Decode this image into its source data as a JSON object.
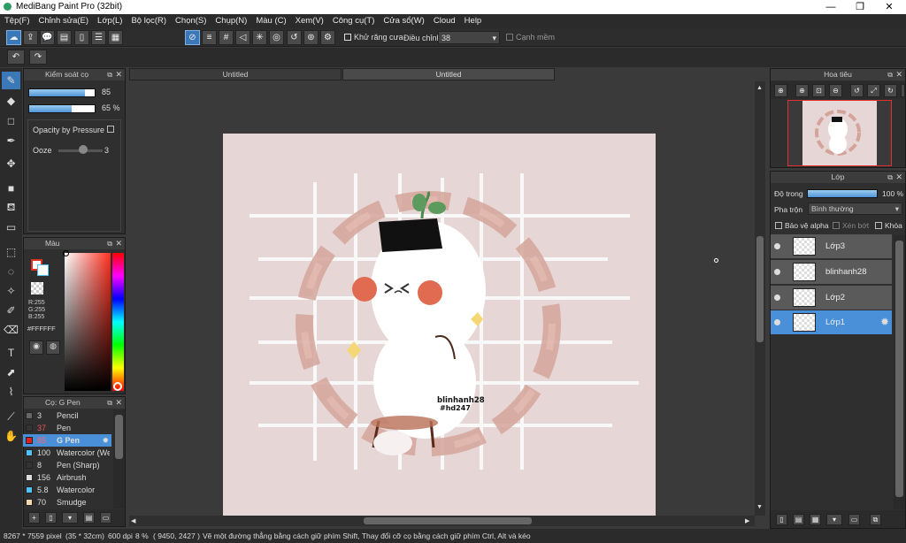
{
  "window": {
    "title": "MediBang Paint Pro (32bit)",
    "minimize": "—",
    "maximize": "❐",
    "close": "✕"
  },
  "menu": [
    "Tệp(F)",
    "Chỉnh sửa(E)",
    "Lớp(L)",
    "Bộ lọc(R)",
    "Chọn(S)",
    "Chụp(N)",
    "Màu (C)",
    "Xem(V)",
    "Công cụ(T)",
    "Cửa sổ(W)",
    "Cloud",
    "Help"
  ],
  "toolbar": {
    "antialias_label": "Khử răng cưa",
    "adjust_label": "Điều chỉnh",
    "adjust_value": "38",
    "edge_label": "Cạnh mềm"
  },
  "tabs": [
    "Untitled",
    "Untitled"
  ],
  "brush_control": {
    "title": "Kiểm soát cọ",
    "size_value": "85",
    "size_fraction": 0.85,
    "opacity_value": "65 %",
    "opacity_fraction": 0.65,
    "opacity_pressure_label": "Opacity by Pressure",
    "ooze_label": "Ooze",
    "ooze_value": "3"
  },
  "color_panel": {
    "title": "Màu",
    "r": "R:255",
    "g": "G:255",
    "b": "B:255",
    "hex": "#FFFFFF"
  },
  "brush_list": {
    "title": "Cọ: G Pen",
    "items": [
      {
        "size": "3",
        "name": "Pencil",
        "color": "#666666"
      },
      {
        "size": "37",
        "name": "Pen",
        "color": "#333333"
      },
      {
        "size": "85",
        "name": "G Pen",
        "color": "#e02020"
      },
      {
        "size": "100",
        "name": "Watercolor (We",
        "color": "#4fc3f7"
      },
      {
        "size": "8",
        "name": "Pen (Sharp)",
        "color": "#333333"
      },
      {
        "size": "156",
        "name": "Airbrush",
        "color": "#dddddd"
      },
      {
        "size": "5.8",
        "name": "Watercolor",
        "color": "#4fc3f7"
      },
      {
        "size": "70",
        "name": "Smudge",
        "color": "#f5d6b0"
      }
    ]
  },
  "navigator": {
    "title": "Hoa tiêu"
  },
  "layer_panel": {
    "title": "Lớp",
    "opacity_label": "Độ trong",
    "opacity_value": "100 %",
    "opacity_fraction": 1.0,
    "blend_label": "Pha trộn",
    "blend_value": "Bình thường",
    "protect_alpha": "Bảo vệ alpha",
    "clip": "Xén bớt",
    "lock": "Khóa",
    "layers": [
      "Lớp3",
      "blinhanh28",
      "Lớp2",
      "Lớp1"
    ]
  },
  "canvas": {
    "background": "#e6d6d6",
    "watermark_line1": "blinhanh28",
    "watermark_line2": "#hd247"
  },
  "status": {
    "size": "8267 * 7559 pixel",
    "cm": "(35 * 32cm)",
    "dpi": "600 dpi",
    "zoom": "8 %",
    "coords": "( 9450, 2427 )",
    "hint": "Vẽ một đường thẳng bằng cách giữ phím Shift, Thay đổi cỡ cọ bằng cách giữ phím Ctrl, Alt và kéo"
  },
  "colors": {
    "accent": "#4a90d9",
    "panel": "#2f2f2f",
    "canvas_bg": "#3a3a3a"
  }
}
